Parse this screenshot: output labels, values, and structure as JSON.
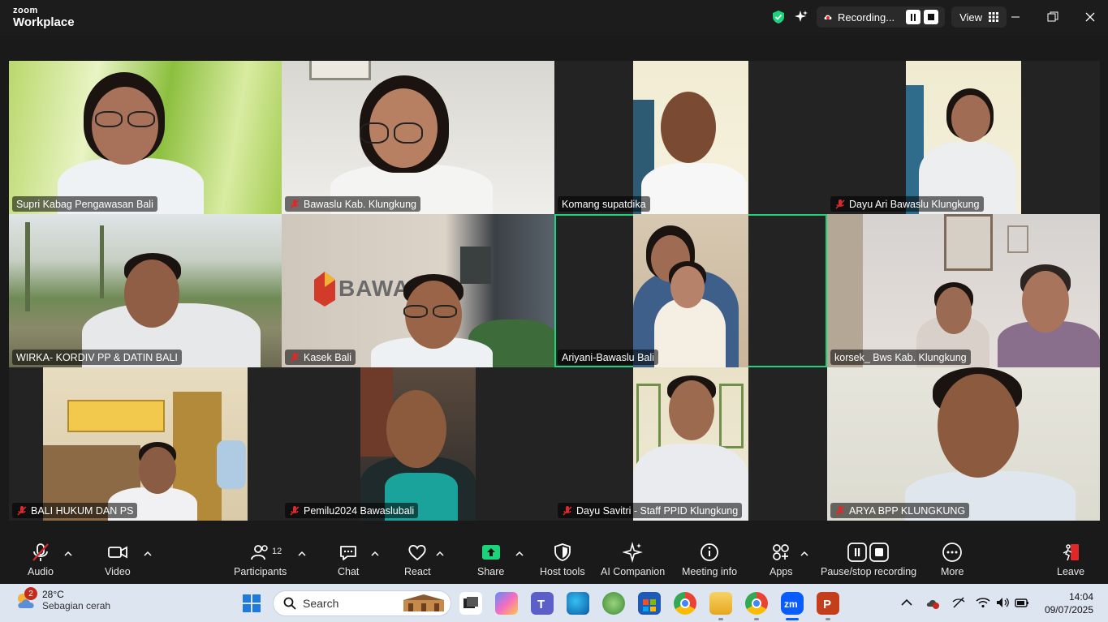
{
  "app": {
    "brand_top": "zoom",
    "brand_bottom": "Workplace"
  },
  "titlebar": {
    "recording_label": "Recording...",
    "view_label": "View"
  },
  "participants": [
    {
      "name": "Supri Kabag Pengawasan Bali",
      "muted": false
    },
    {
      "name": "Bawaslu Kab. Klungkung",
      "muted": true
    },
    {
      "name": "Komang supatdika",
      "muted": false
    },
    {
      "name": "Dayu Ari Bawaslu Klungkung",
      "muted": true
    },
    {
      "name": "WIRKA- KORDIV PP & DATIN BALI",
      "muted": false
    },
    {
      "name": "Kasek Bali",
      "muted": true
    },
    {
      "name": "Ariyani-Bawaslu Bali",
      "muted": false,
      "active_speaker": true
    },
    {
      "name": "korsek_ Bws Kab. Klungkung",
      "muted": false
    },
    {
      "name": "BALI HUKUM DAN PS",
      "muted": true
    },
    {
      "name": "Pemilu2024 Bawaslubali",
      "muted": true
    },
    {
      "name": "Dayu Savitri - Staff PPID Klungkung",
      "muted": true
    },
    {
      "name": "ARYA BPP KLUNGKUNG",
      "muted": true
    }
  ],
  "scene_text": {
    "bawaslu_sign": "BAWASLU"
  },
  "toolbar": {
    "audio": "Audio",
    "video": "Video",
    "participants": "Participants",
    "participants_count": "12",
    "chat": "Chat",
    "react": "React",
    "share": "Share",
    "host_tools": "Host tools",
    "ai_companion": "AI Companion",
    "meeting_info": "Meeting info",
    "apps": "Apps",
    "pause_stop_recording": "Pause/stop recording",
    "more": "More",
    "leave": "Leave"
  },
  "taskbar": {
    "temperature": "28°C",
    "condition": "Sebagian cerah",
    "weather_badge": "2",
    "search_placeholder": "Search",
    "time": "14:04",
    "date": "09/07/2025"
  },
  "colors": {
    "active_speaker_border": "#1bd37a",
    "share_green": "#1bd37a",
    "leave_red": "#e02828",
    "muted_red": "#e02828"
  }
}
